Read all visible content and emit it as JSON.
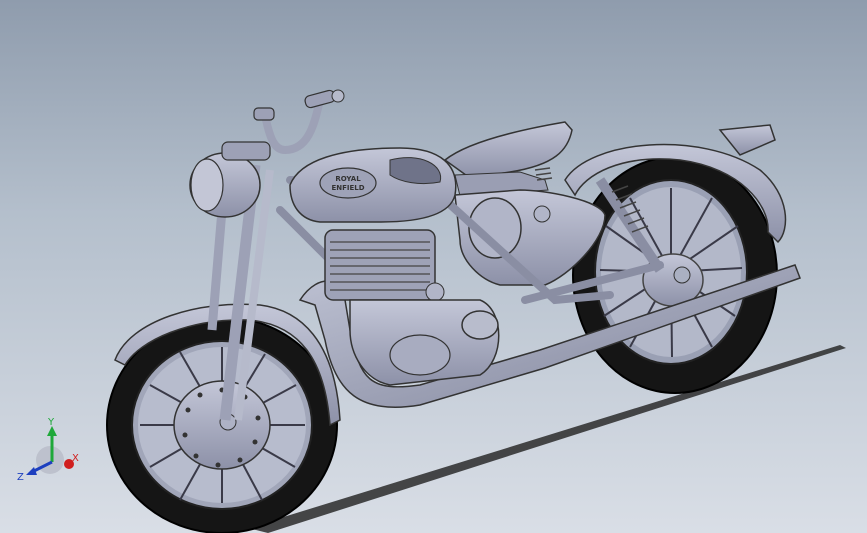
{
  "viewport": {
    "background_top": "#8f9cad",
    "background_bottom": "#d9dee6",
    "model_color": "#a9adc2",
    "tire_color": "#151515"
  },
  "tank_badge": {
    "line1": "ROYAL",
    "line2": "ENFIELD"
  },
  "triad": {
    "x_label": "X",
    "y_label": "Y",
    "z_label": "Z",
    "x_color": "#d01e1e",
    "y_color": "#1fa83a",
    "z_color": "#1d3fbf"
  }
}
